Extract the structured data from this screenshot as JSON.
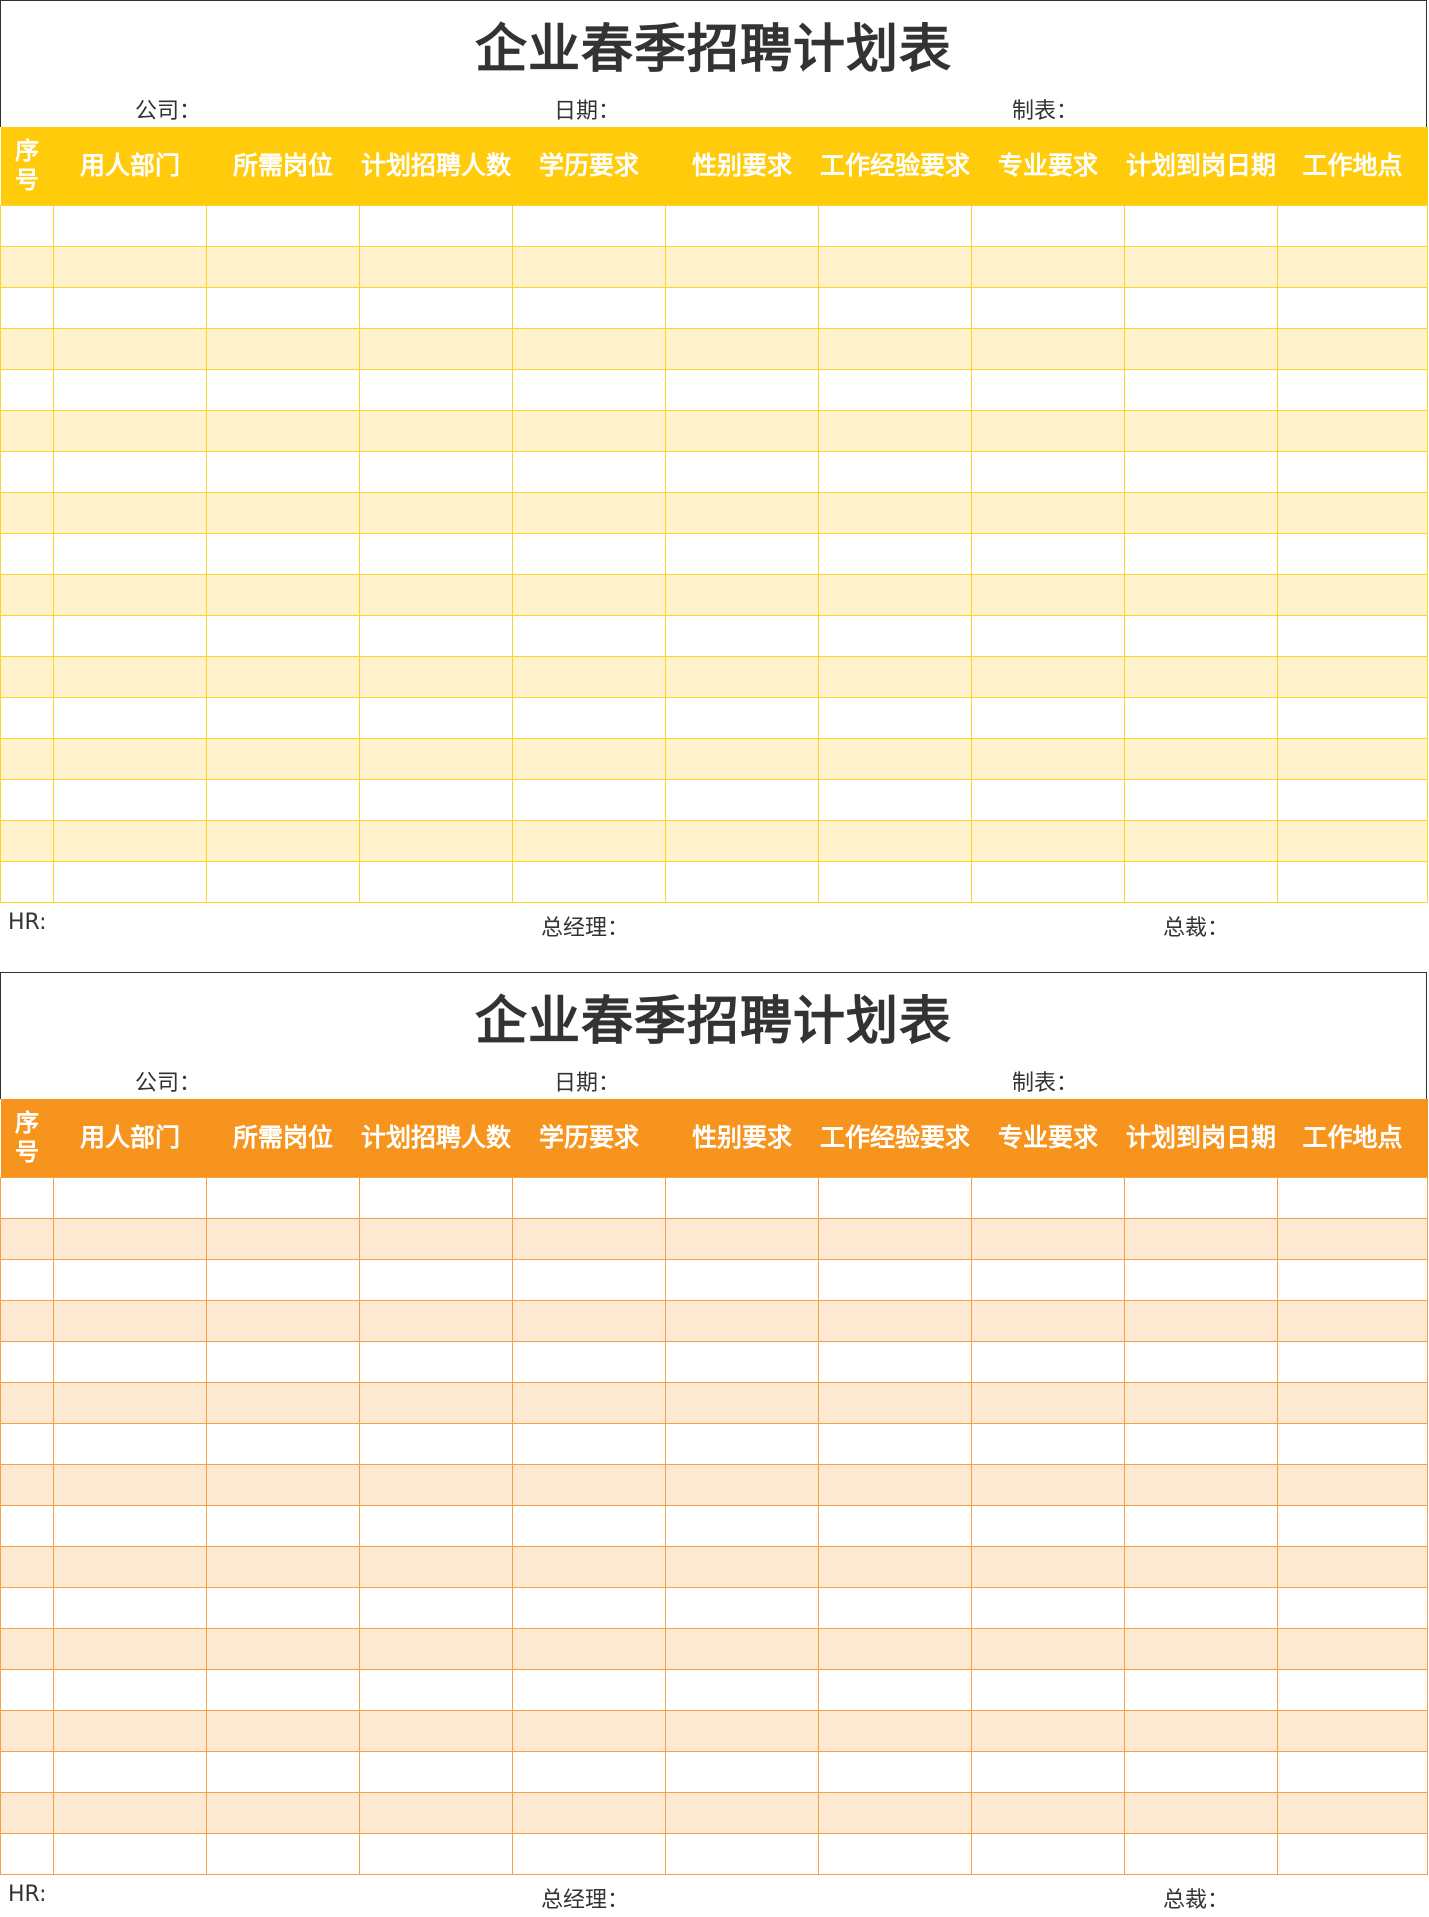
{
  "sheets": [
    {
      "title": "企业春季招聘计划表",
      "company_label": "公司：",
      "date_label": "日期：",
      "maker_label": "制表：",
      "footer": {
        "hr": "HR:",
        "gm": "总经理：",
        "ceo": "总裁："
      }
    },
    {
      "title": "企业春季招聘计划表",
      "company_label": "公司：",
      "date_label": "日期：",
      "maker_label": "制表：",
      "footer": {
        "hr": "HR:",
        "gm": "总经理：",
        "ceo": "总裁："
      }
    }
  ],
  "columns": [
    "序\n号",
    "用人部门",
    "所需岗位",
    "计划招聘人数",
    "学历要求",
    "性别要求",
    "工作经验要求",
    "专业要求",
    "计划到岗日期",
    "工作地点"
  ],
  "row_count": 17,
  "colors": {
    "sheet1_header": "#ffcb0b",
    "sheet1_alt_row": "#fff2cc",
    "sheet2_header": "#f7941d",
    "sheet2_alt_row": "#fde8d1"
  }
}
